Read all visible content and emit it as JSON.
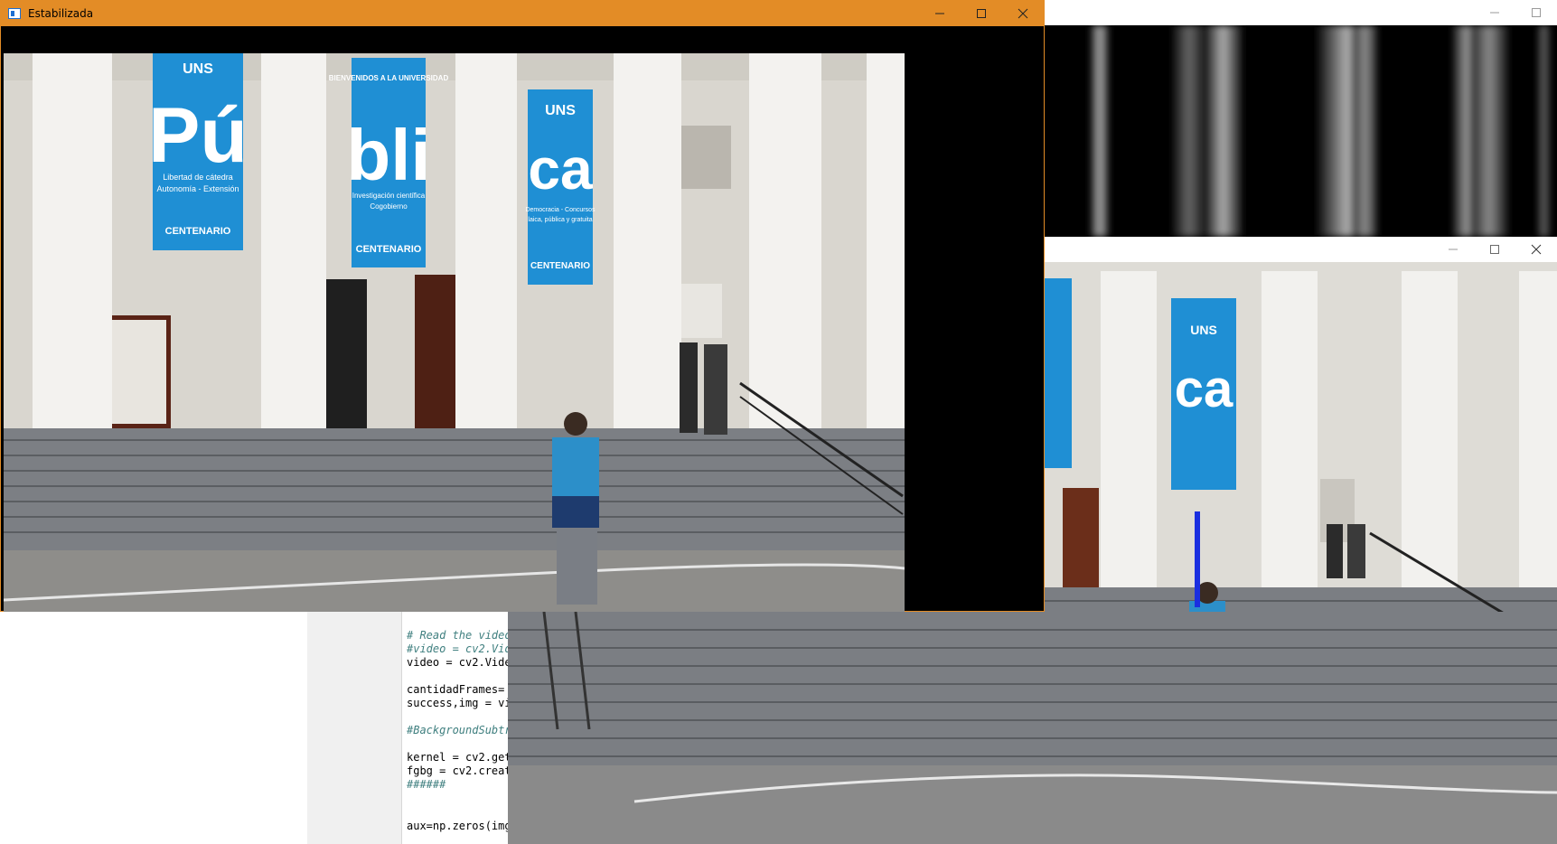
{
  "windows": {
    "main": {
      "title": "Estabilizada",
      "controls": [
        "minimize",
        "maximize",
        "close"
      ]
    },
    "mask": {
      "title": "",
      "controls": [
        "minimize",
        "maximize"
      ]
    },
    "stabilized2": {
      "title": "",
      "controls": [
        "minimize",
        "maximize",
        "close"
      ]
    }
  },
  "banners": {
    "b1": {
      "top": "UNS",
      "big": "Pú",
      "lines": [
        "Libertad de cátedra",
        "Autonomía - Extensión"
      ],
      "footer": "CENTENARIO"
    },
    "b2": {
      "top": "BIENVENIDOS A LA UNIVERSIDAD",
      "big": "bli",
      "lines": [
        "Investigación científica",
        "Cogobierno"
      ],
      "footer": "CENTENARIO"
    },
    "b3": {
      "top": "UNS",
      "big": "ca",
      "lines": [
        "Democracia - Concursos",
        "laica, pública y gratuita"
      ],
      "footer": "CENTENARIO"
    }
  },
  "editor": {
    "lines": [
      {
        "text": "# Read the video",
        "type": "comment"
      },
      {
        "text": "#video = cv2.Vid",
        "type": "comment"
      },
      {
        "text": "video = cv2.Vide",
        "type": "code"
      },
      {
        "text": "",
        "type": "code"
      },
      {
        "text": "cantidadFrames=",
        "type": "code"
      },
      {
        "text": "success,img = vi",
        "type": "code"
      },
      {
        "text": "",
        "type": "code"
      },
      {
        "text": "#BackgroundSubtr",
        "type": "comment"
      },
      {
        "text": "",
        "type": "code"
      },
      {
        "text": "kernel = cv2.get",
        "type": "code"
      },
      {
        "text": "fgbg = cv2.creat",
        "type": "code"
      },
      {
        "text": "######",
        "type": "comment"
      },
      {
        "text": "",
        "type": "code"
      },
      {
        "text": "",
        "type": "code"
      },
      {
        "text": "aux=np.zeros(img",
        "type": "code"
      }
    ]
  },
  "colors": {
    "titlebar_active": "#e38c26",
    "banner_blue": "#1f8fd4",
    "indicator_blue": "#1a2fe0"
  }
}
